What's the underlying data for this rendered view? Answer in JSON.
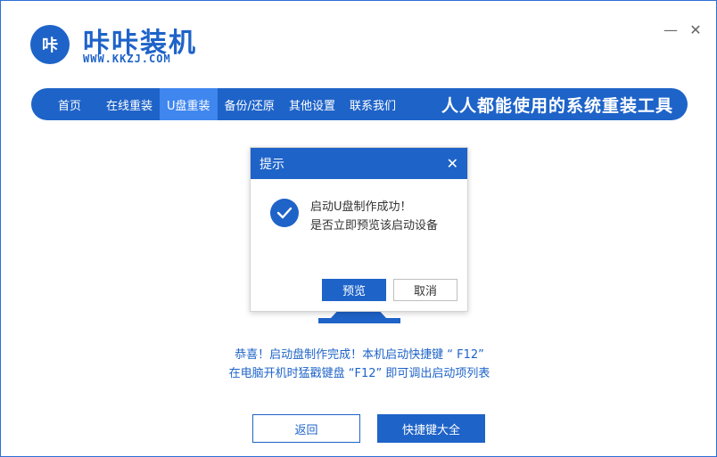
{
  "header": {
    "logo_text": "咔",
    "title": "咔咔装机",
    "url": "WWW.KKZJ.COM",
    "minimize_label": "—",
    "close_label": "✕"
  },
  "nav": {
    "items": [
      {
        "label": "首页"
      },
      {
        "label": "在线重装"
      },
      {
        "label": "U盘重装"
      },
      {
        "label": "备份/还原"
      },
      {
        "label": "其他设置"
      },
      {
        "label": "联系我们"
      }
    ],
    "active_index": 2,
    "slogan": "人人都能使用的系统重装工具"
  },
  "dialog": {
    "title": "提示",
    "close_label": "✕",
    "message_line1": "启动U盘制作成功！",
    "message_line2": "是否立即预览该启动设备",
    "preview_label": "预览",
    "cancel_label": "取消"
  },
  "main": {
    "message_line1": "恭喜！启动盘制作完成！本机启动快捷键 “ F12”",
    "message_line2": "在电脑开机时猛戳键盘 “F12” 即可调出启动项列表",
    "back_label": "返回",
    "hotkeys_label": "快捷键大全"
  },
  "colors": {
    "primary": "#1e63c8",
    "nav_active": "#3f86ef"
  },
  "icons": {
    "logo": "logo-icon",
    "success": "checkmark-circle-icon"
  }
}
